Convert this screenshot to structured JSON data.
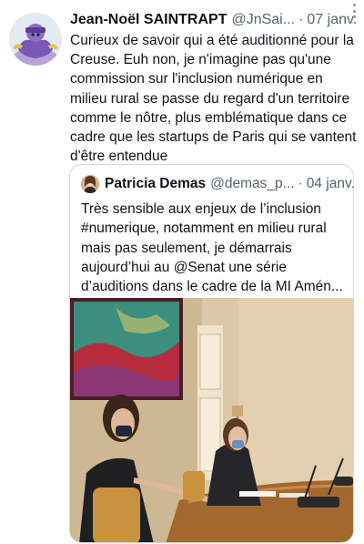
{
  "tweet": {
    "author_name": "Jean-Noël SAINTRAPT",
    "author_handle": "@JnSai...",
    "separator": "·",
    "date": "07 janv.",
    "more_icon": "ellipsis-vertical-icon",
    "text": "Curieux de savoir qui a été auditionné pour la Creuse. Euh non, je n'imagine pas qu'une commission sur l'inclusion numérique en milieu rural se passe du regard d'un territoire comme le nôtre, plus emblématique dans ce cadre que les startups de Paris qui se vantent d'être entendue"
  },
  "quoted": {
    "author_name": "Patricia Demas",
    "author_handle": "@demas_p...",
    "separator": "·",
    "date": "04 janv.",
    "text": "Très sensible aux enjeux de l’inclusion #numerique, notamment en milieu rural mais pas seulement, je démarrais aujourd’hui au @Senat une série d’auditions dans le cadre de la MI Amén..."
  },
  "colors": {
    "text": "#0f1419",
    "secondary": "#536471",
    "border": "#cfd9de"
  }
}
